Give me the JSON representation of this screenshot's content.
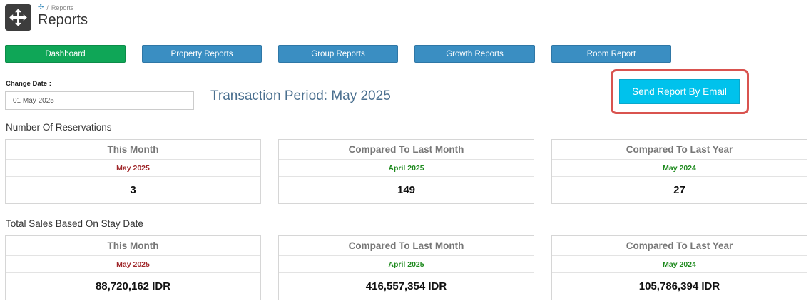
{
  "header": {
    "breadcrumb": "Reports",
    "title": "Reports"
  },
  "nav": {
    "dashboard": "Dashboard",
    "property_reports": "Property Reports",
    "group_reports": "Group Reports",
    "growth_reports": "Growth Reports",
    "room_report": "Room Report"
  },
  "filter": {
    "change_date_label": "Change Date :",
    "date_value": "01 May 2025"
  },
  "period_title": "Transaction Period: May 2025",
  "email_button": "Send Report By Email",
  "colors": {
    "dashboard_green": "#0fa657",
    "nav_blue": "#3a8ec2",
    "email_cyan": "#00c2ec",
    "highlight_red": "#d9534f",
    "current_period_red": "#a0282b",
    "compare_period_green": "#1e8a1e"
  },
  "reservations": {
    "title": "Number Of Reservations",
    "cards": [
      {
        "heading": "This Month",
        "period": "May 2025",
        "value": "3"
      },
      {
        "heading": "Compared To Last Month",
        "period": "April 2025",
        "value": "149"
      },
      {
        "heading": "Compared To Last Year",
        "period": "May 2024",
        "value": "27"
      }
    ]
  },
  "sales": {
    "title": "Total Sales Based On Stay Date",
    "cards": [
      {
        "heading": "This Month",
        "period": "May 2025",
        "value": "88,720,162 IDR"
      },
      {
        "heading": "Compared To Last Month",
        "period": "April 2025",
        "value": "416,557,354 IDR"
      },
      {
        "heading": "Compared To Last Year",
        "period": "May 2024",
        "value": "105,786,394 IDR"
      }
    ]
  }
}
